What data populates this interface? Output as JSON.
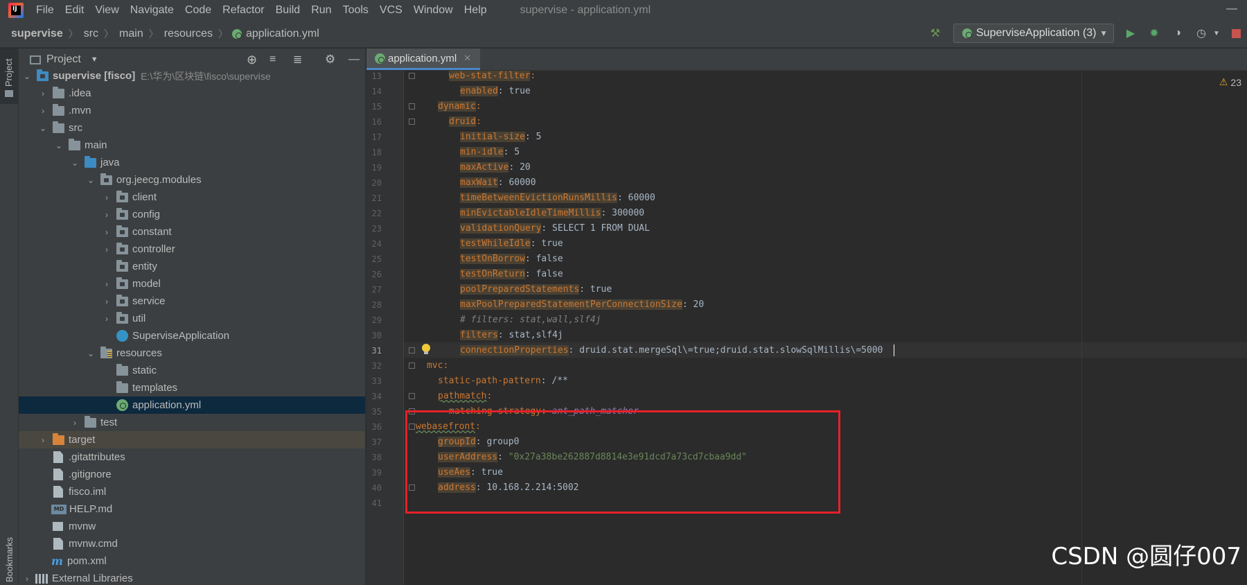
{
  "menubar": {
    "items": [
      "File",
      "Edit",
      "View",
      "Navigate",
      "Code",
      "Refactor",
      "Build",
      "Run",
      "Tools",
      "VCS",
      "Window",
      "Help"
    ],
    "window_title": "supervise - application.yml"
  },
  "breadcrumbs": [
    "supervise",
    "src",
    "main",
    "resources",
    "application.yml"
  ],
  "run_config": {
    "label": "SuperviseApplication (3)"
  },
  "project_panel": {
    "title": "Project",
    "root": {
      "name": "supervise [fisco]",
      "path": "E:\\华为\\区块链\\fisco\\supervise"
    },
    "items": [
      ".idea",
      ".mvn",
      "src",
      "main",
      "java",
      "org.jeecg.modules",
      "client",
      "config",
      "constant",
      "controller",
      "entity",
      "model",
      "service",
      "util",
      "SuperviseApplication",
      "resources",
      "static",
      "templates",
      "application.yml",
      "test",
      "target",
      ".gitattributes",
      ".gitignore",
      "fisco.iml",
      "HELP.md",
      "mvnw",
      "mvnw.cmd",
      "pom.xml",
      "External Libraries"
    ]
  },
  "strip": {
    "project": "Project",
    "bookmarks": "Bookmarks"
  },
  "editor": {
    "tab_label": "application.yml",
    "warnings_count": "23",
    "line_numbers": [
      "13",
      "14",
      "15",
      "16",
      "17",
      "18",
      "19",
      "20",
      "21",
      "22",
      "23",
      "24",
      "25",
      "26",
      "27",
      "28",
      "29",
      "30",
      "31",
      "32",
      "33",
      "34",
      "35",
      "36",
      "37",
      "38",
      "39",
      "40",
      "41"
    ],
    "lines": {
      "l13_key": "web-stat-filter",
      "l13_rest": ":",
      "l14_key": "enabled",
      "l14_rest": ": true",
      "l15_key": "dynamic",
      "l15_rest": ":",
      "l16_key": "druid",
      "l16_rest": ":",
      "l17_key": "initial-size",
      "l17_rest": ": 5",
      "l18_key": "min-idle",
      "l18_rest": ": 5",
      "l19_key": "maxActive",
      "l19_rest": ": 20",
      "l20_key": "maxWait",
      "l20_rest": ": 60000",
      "l21_key": "timeBetweenEvictionRunsMillis",
      "l21_rest": ": 60000",
      "l22_key": "minEvictableIdleTimeMillis",
      "l22_rest": ": 300000",
      "l23_key": "validationQuery",
      "l23_rest": ": SELECT 1 FROM DUAL",
      "l24_key": "testWhileIdle",
      "l24_rest": ": true",
      "l25_key": "testOnBorrow",
      "l25_rest": ": false",
      "l26_key": "testOnReturn",
      "l26_rest": ": false",
      "l27_key": "poolPreparedStatements",
      "l27_rest": ": true",
      "l28_key": "maxPoolPreparedStatementPerConnectionSize",
      "l28_rest": ": 20",
      "l29_comment": "# filters: stat,wall,slf4j",
      "l30_key": "filters",
      "l30_rest": ": stat,slf4j",
      "l31_key": "connectionProperties",
      "l31_rest": ": druid.stat.mergeSql\\=true;druid.stat.slowSqlMillis\\=5000",
      "l32_key": "mvc",
      "l32_rest": ":",
      "l33_key": "static-path-pattern",
      "l33_rest": ": /**",
      "l34_key": "pathmatch",
      "l34_rest": ":",
      "l35_key": "matching-strategy",
      "l35_rest": ":",
      "l35_value": "ant_path_matcher",
      "l36_key": "webasefront",
      "l36_rest": ":",
      "l37_key": "groupId",
      "l37_rest": ": group0",
      "l38_key": "userAddress",
      "l38_colon": ": ",
      "l38_value": "\"0x27a38be262887d8814e3e91dcd7a73cd7cbaa9dd\"",
      "l39_key": "useAes",
      "l39_rest": ": true",
      "l40_key": "address",
      "l40_rest": ": 10.168.2.214:5002"
    }
  },
  "watermark": "CSDN @圆仔007",
  "colors": {
    "accent": "#4a88c7",
    "highlight_box": "#e8202a",
    "yaml_key": "#cc7832",
    "string": "#6a8759"
  }
}
